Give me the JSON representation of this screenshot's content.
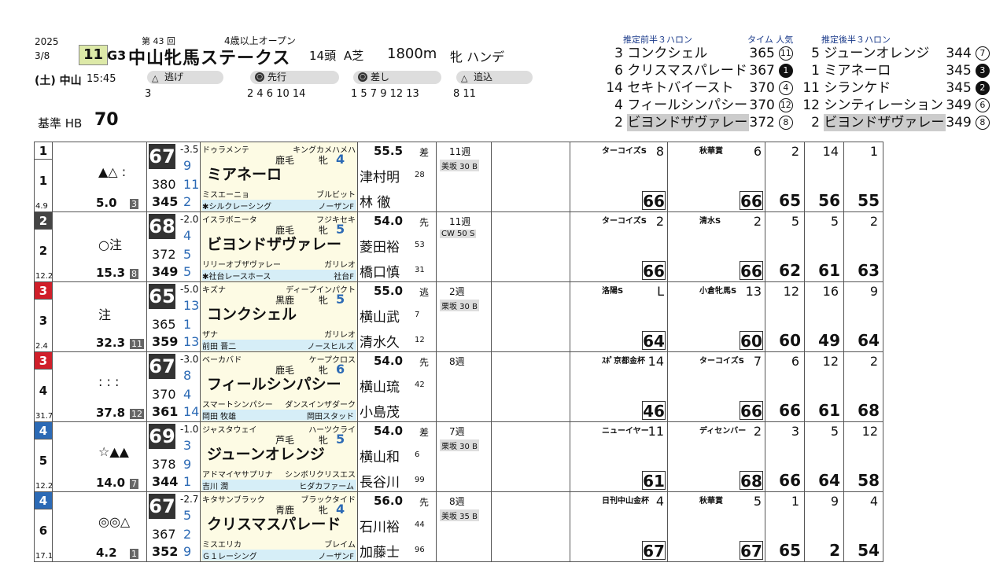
{
  "race": {
    "year": "2025",
    "date": "3/8",
    "day": "(土) 中山",
    "time": "15:45",
    "number": "11",
    "grade": "G3",
    "kai": "第 43 回",
    "name": "中山牝馬ステークス",
    "cond": "4歳以上オープン",
    "heads": "14頭",
    "turf": "A芝",
    "dist": "1800m",
    "handicap": "牝 ハンデ",
    "base_label": "基準 HB",
    "base_value": "70"
  },
  "styles": [
    {
      "label": "逃げ",
      "horses": "3"
    },
    {
      "label": "先行",
      "horses": "2 4 6 10 14"
    },
    {
      "label": "差し",
      "horses": "1 5 7 9 12 13"
    },
    {
      "label": "追込",
      "horses": "8 11"
    }
  ],
  "pred": {
    "first_head": "推定前半３ハロン",
    "time_head": "タイム 人気",
    "second_head": "推定後半３ハロン",
    "first": [
      {
        "num": "3",
        "name": "コンクシェル",
        "time": "365",
        "pop": "11",
        "fill": false
      },
      {
        "num": "6",
        "name": "クリスマスパレード",
        "time": "367",
        "pop": "1",
        "fill": true
      },
      {
        "num": "14",
        "name": "セキトバイースト",
        "time": "370",
        "pop": "4",
        "fill": false
      },
      {
        "num": "4",
        "name": "フィールシンパシー",
        "time": "370",
        "pop": "12",
        "fill": false
      },
      {
        "num": "2",
        "name": "ビヨンドザヴァレー",
        "time": "372",
        "pop": "8",
        "fill": false
      }
    ],
    "second": [
      {
        "num": "5",
        "name": "ジューンオレンジ",
        "time": "344",
        "pop": "7",
        "fill": false
      },
      {
        "num": "1",
        "name": "ミアネーロ",
        "time": "345",
        "pop": "3",
        "fill": true
      },
      {
        "num": "11",
        "name": "シランケド",
        "time": "345",
        "pop": "2",
        "fill": true
      },
      {
        "num": "12",
        "name": "シンティレーション",
        "time": "349",
        "pop": "6",
        "fill": false
      },
      {
        "num": "2",
        "name": "ビヨンドザヴァレー",
        "time": "349",
        "pop": "8",
        "fill": false
      }
    ]
  },
  "horses": [
    {
      "frame": "1",
      "num": "1",
      "frame_color": "#ffffff",
      "frame_text": "#111",
      "rank": "4.9",
      "marks": "▲△ :",
      "odds": "5.0",
      "pop": "3",
      "rating": "67",
      "r1": "-3.5",
      "r2": "9",
      "r3": "380",
      "r4": "11",
      "r5": "345",
      "r6": "2",
      "sire": "ドゥラメンテ",
      "damsire": "キングカメハメハ",
      "color": "鹿毛",
      "sex": "牝",
      "age": "4",
      "name": "ミアネーロ",
      "dam": "ミスエーニョ",
      "bms": "ブルビット",
      "owner": "✱シルクレーシング",
      "farm": "ノーザンF",
      "weight": "55.5",
      "style": "差",
      "jockey1": "津村明",
      "j1age": "28",
      "jockey2": "林 徹",
      "j2age": "",
      "weeks": "11週",
      "train": "美坂 30 B",
      "past1": "ターコイズS",
      "past1_res": "8",
      "past1_rating": "66",
      "past2": "秋華賞",
      "past2_res": "6",
      "past2_rating": "66",
      "r_a": "2",
      "r_b": "14",
      "r_c": "1",
      "r_a_val": "65",
      "r_b_val": "56",
      "r_c_val": "55"
    },
    {
      "frame": "2",
      "num": "2",
      "frame_color": "#444444",
      "frame_text": "#fff",
      "rank": "12.2",
      "marks": "○注",
      "odds": "15.3",
      "pop": "8",
      "rating": "68",
      "r1": "-2.0",
      "r2": "4",
      "r3": "372",
      "r4": "5",
      "r5": "349",
      "r6": "5",
      "sire": "イスラボニータ",
      "damsire": "フジキセキ",
      "color": "鹿毛",
      "sex": "牝",
      "age": "5",
      "name": "ビヨンドザヴァレー",
      "dam": "リリーオブザヴァレー",
      "bms": "ガリレオ",
      "owner": "✱社台レースホース",
      "farm": "社台F",
      "weight": "54.0",
      "style": "先",
      "jockey1": "菱田裕",
      "j1age": "53",
      "jockey2": "橋口慎",
      "j2age": "31",
      "weeks": "11週",
      "train": "CW 50 S",
      "past1": "ターコイズS",
      "past1_res": "2",
      "past1_rating": "66",
      "past2": "清水S",
      "past2_res": "2",
      "past2_rating": "66",
      "r_a": "5",
      "r_b": "5",
      "r_c": "2",
      "r_a_val": "62",
      "r_b_val": "61",
      "r_c_val": "63"
    },
    {
      "frame": "3",
      "num": "3",
      "frame_color": "#d01f2a",
      "frame_text": "#fff",
      "rank": "2.4",
      "marks": "注",
      "odds": "32.3",
      "pop": "11",
      "rating": "65",
      "r1": "-5.0",
      "r2": "13",
      "r3": "365",
      "r4": "1",
      "r5": "359",
      "r6": "13",
      "sire": "キズナ",
      "damsire": "ディープインパクト",
      "color": "黒鹿",
      "sex": "牝",
      "age": "5",
      "name": "コンクシェル",
      "dam": "ザナ",
      "bms": "ガリレオ",
      "owner": "前田 晋二",
      "farm": "ノースヒルズ",
      "weight": "55.0",
      "style": "逃",
      "jockey1": "横山武",
      "j1age": "7",
      "jockey2": "清水久",
      "j2age": "12",
      "weeks": "2週",
      "train": "栗坂 30 B",
      "past1": "洛陽S",
      "past1_res": "L",
      "past1_rating": "64",
      "past2": "小倉牝馬S",
      "past2_res": "13",
      "past2_rating": "60",
      "r_a": "12",
      "r_b": "16",
      "r_c": "9",
      "r_a_val": "60",
      "r_b_val": "49",
      "r_c_val": "64"
    },
    {
      "frame": "3",
      "num": "4",
      "frame_color": "#d01f2a",
      "frame_text": "#fff",
      "rank": "31.7",
      "marks": ": : :",
      "odds": "37.8",
      "pop": "12",
      "rating": "67",
      "r1": "-3.0",
      "r2": "8",
      "r3": "370",
      "r4": "4",
      "r5": "361",
      "r6": "14",
      "sire": "ベーカバド",
      "damsire": "ケープクロス",
      "color": "鹿毛",
      "sex": "牝",
      "age": "6",
      "name": "フィールシンパシー",
      "dam": "スマートシンパシー",
      "bms": "ダンスインザダーク",
      "owner": "岡田 牧雄",
      "farm": "岡田スタッド",
      "weight": "54.0",
      "style": "先",
      "jockey1": "横山琉",
      "j1age": "42",
      "jockey2": "小島茂",
      "j2age": "",
      "weeks": "8週",
      "train": "",
      "past1": "ｽﾎﾟ京都金杯",
      "past1_res": "14",
      "past1_rating": "46",
      "past2": "ターコイズS",
      "past2_res": "7",
      "past2_rating": "66",
      "r_a": "6",
      "r_b": "12",
      "r_c": "2",
      "r_a_val": "66",
      "r_b_val": "61",
      "r_c_val": "68"
    },
    {
      "frame": "4",
      "num": "5",
      "frame_color": "#2c6ab5",
      "frame_text": "#fff",
      "rank": "12.2",
      "marks": "☆▲▲",
      "odds": "14.0",
      "pop": "7",
      "rating": "69",
      "r1": "-1.0",
      "r2": "3",
      "r3": "378",
      "r4": "9",
      "r5": "344",
      "r6": "1",
      "sire": "ジャスタウェイ",
      "damsire": "ハーツクライ",
      "color": "芦毛",
      "sex": "牝",
      "age": "5",
      "name": "ジューンオレンジ",
      "dam": "アドマイヤサプリナ",
      "bms": "シンボリクリスエス",
      "owner": "吉川 潤",
      "farm": "ヒダカファーム",
      "weight": "54.0",
      "style": "差",
      "jockey1": "横山和",
      "j1age": "6",
      "jockey2": "長谷川",
      "j2age": "99",
      "weeks": "7週",
      "train": "栗坂 30 B",
      "past1": "ニューイヤー",
      "past1_res": "11",
      "past1_rating": "61",
      "past2": "ディセンバー",
      "past2_res": "2",
      "past2_rating": "68",
      "r_a": "3",
      "r_b": "5",
      "r_c": "12",
      "r_a_val": "66",
      "r_b_val": "64",
      "r_c_val": "58"
    },
    {
      "frame": "4",
      "num": "6",
      "frame_color": "#2c6ab5",
      "frame_text": "#fff",
      "rank": "17.1",
      "marks": "◎◎△",
      "odds": "4.2",
      "pop": "1",
      "rating": "67",
      "r1": "-2.7",
      "r2": "5",
      "r3": "367",
      "r4": "2",
      "r5": "352",
      "r6": "9",
      "sire": "キタサンブラック",
      "damsire": "ブラックタイド",
      "color": "青鹿",
      "sex": "牝",
      "age": "4",
      "name": "クリスマスパレード",
      "dam": "ミスエリカ",
      "bms": "ブレイム",
      "owner": "Ｇ１レーシング",
      "farm": "ノーザンF",
      "weight": "56.0",
      "style": "先",
      "jockey1": "石川裕",
      "j1age": "44",
      "jockey2": "加藤士",
      "j2age": "96",
      "weeks": "8週",
      "train": "美坂 35 B",
      "past1": "日刊中山金杯",
      "past1_res": "4",
      "past1_rating": "67",
      "past2": "秋華賞",
      "past2_res": "5",
      "past2_rating": "67",
      "r_a": "1",
      "r_b": "9",
      "r_c": "4",
      "r_a_val": "65",
      "r_b_val": "2",
      "r_c_val": "54"
    }
  ]
}
